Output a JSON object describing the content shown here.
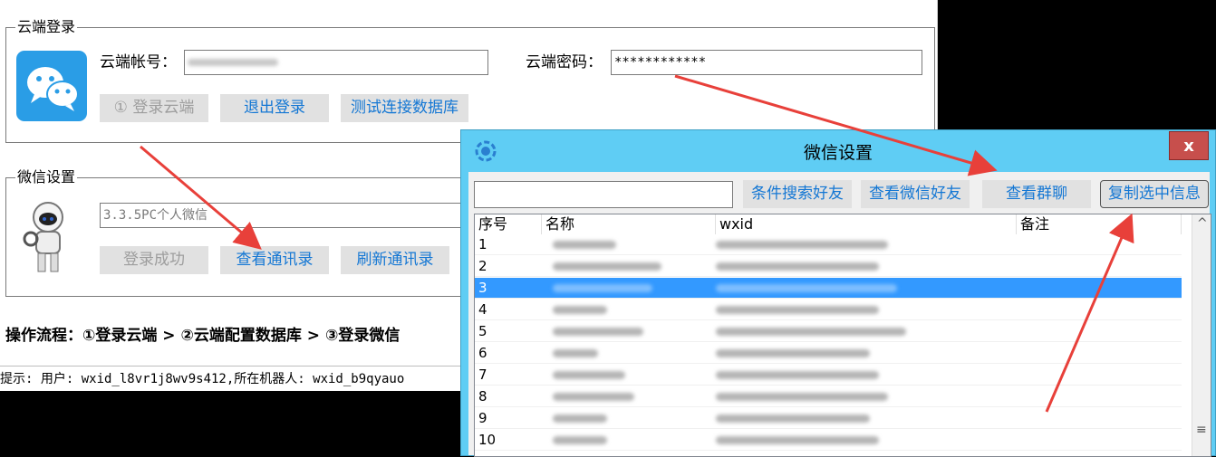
{
  "main": {
    "cloud_group": {
      "title": "云端登录"
    },
    "account_label": "云端帐号：",
    "password_label": "云端密码：",
    "password_value": "************",
    "buttons": {
      "login_cloud": "① 登录云端",
      "logout": "退出登录",
      "test_db": "测试连接数据库"
    },
    "wechat_group": {
      "title": "微信设置"
    },
    "wechat_version_value": "3.3.5PC个人微信",
    "wechat_buttons": {
      "login_success": "登录成功",
      "view_contacts": "查看通讯录",
      "refresh_contacts": "刷新通讯录"
    },
    "flow_text": "操作流程：①登录云端 > ②云端配置数据库 > ③登录微信",
    "status_text": "提示: 用户: wxid_l8vr1j8wv9s412,所在机器人: wxid_b9qyauo"
  },
  "dialog": {
    "title": "微信设置",
    "close_label": "x",
    "search_value": "",
    "buttons": {
      "search_friends": "条件搜索好友",
      "view_friends": "查看微信好友",
      "view_groups": "查看群聊",
      "copy_selected": "复制选中信息"
    },
    "table": {
      "columns": [
        "序号",
        "名称",
        "wxid",
        "备注"
      ],
      "rows": [
        "1",
        "2",
        "3",
        "4",
        "5",
        "6",
        "7",
        "8",
        "9",
        "10"
      ],
      "selected_index": 2
    },
    "scroll_up": "^",
    "scroll_grip": "≡"
  },
  "colors": {
    "dialog_bg": "#5fcdf4",
    "button_text": "#1477d4",
    "selection": "#3399ff",
    "arrow": "#e8403a",
    "close": "#c74f4c"
  },
  "icons": [
    "wechat-logo-icon",
    "robot-icon",
    "dialog-app-icon",
    "close-icon"
  ]
}
